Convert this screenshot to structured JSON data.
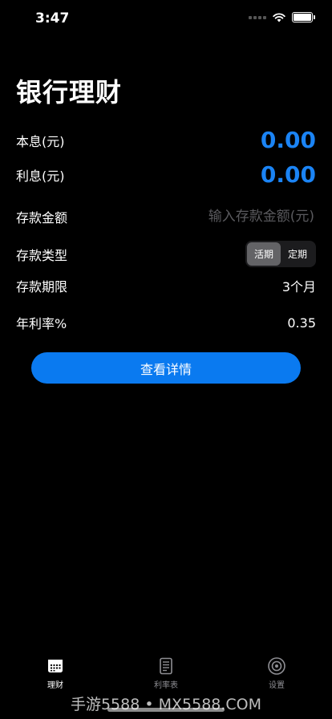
{
  "status": {
    "time": "3:47"
  },
  "page": {
    "title": "银行理财"
  },
  "rows": {
    "principal_interest": {
      "label": "本息(元)",
      "value": "0.00"
    },
    "interest": {
      "label": "利息(元)",
      "value": "0.00"
    },
    "deposit_amount": {
      "label": "存款金额",
      "placeholder": "输入存款金额(元)"
    },
    "deposit_type": {
      "label": "存款类型",
      "options": [
        "活期",
        "定期"
      ],
      "selected": "活期"
    },
    "deposit_term": {
      "label": "存款期限",
      "value": "3个月"
    },
    "annual_rate": {
      "label": "年利率%",
      "value": "0.35"
    }
  },
  "button": {
    "label": "查看详情"
  },
  "tabs": [
    {
      "label": "理财",
      "icon": "calendar-icon",
      "active": true
    },
    {
      "label": "利率表",
      "icon": "document-icon",
      "active": false
    },
    {
      "label": "设置",
      "icon": "gear-icon",
      "active": false
    }
  ],
  "watermark": "手游5588 • MX5588.COM"
}
